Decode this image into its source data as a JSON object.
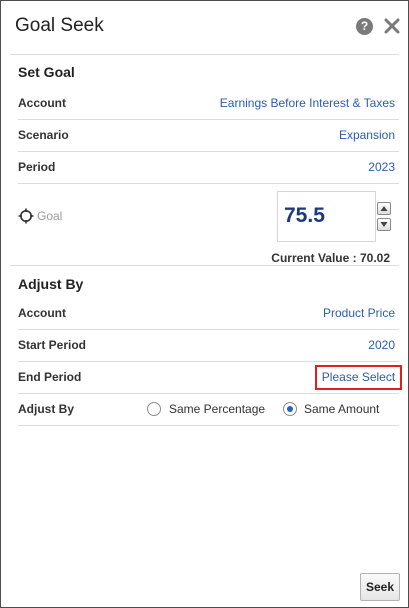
{
  "dialog": {
    "title": "Goal Seek",
    "help_icon": "question-circle-icon",
    "close_icon": "close-x-icon"
  },
  "set_goal": {
    "title": "Set Goal",
    "rows": [
      {
        "label": "Account",
        "value": "Earnings Before Interest & Taxes"
      },
      {
        "label": "Scenario",
        "value": "Expansion"
      },
      {
        "label": "Period",
        "value": "2023"
      }
    ],
    "goal": {
      "icon": "target-crosshair-icon",
      "label": "Goal",
      "value": "75.5",
      "current_value_text": "Current Value : 70.02"
    }
  },
  "adjust_by": {
    "title": "Adjust By",
    "rows": [
      {
        "label": "Account",
        "value": "Product Price"
      },
      {
        "label": "Start Period",
        "value": "2020"
      },
      {
        "label": "End Period",
        "value": "Please Select"
      }
    ],
    "method": {
      "label": "Adjust By",
      "options": [
        {
          "label": "Same Percentage",
          "selected": false
        },
        {
          "label": "Same Amount",
          "selected": true
        }
      ]
    }
  },
  "footer": {
    "seek_label": "Seek"
  },
  "colors": {
    "link": "#2a5db0",
    "highlight_border": "#e0201b",
    "goal_value": "#1f3a7a",
    "radio_selected": "#1f66c4"
  }
}
